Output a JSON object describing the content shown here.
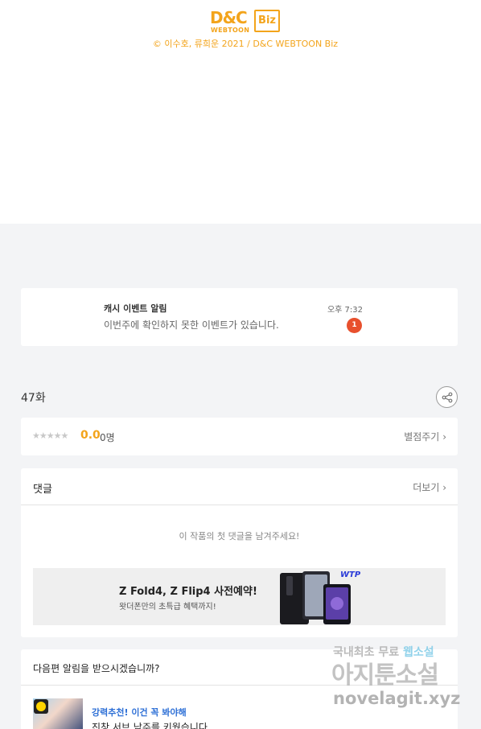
{
  "header": {
    "logo_text": "D&C WEBTOON Biz",
    "logo_dc": "D&C",
    "logo_webtoon": "WEBTOON",
    "logo_biz": "Biz",
    "copyright": "© 이수호, 류희운 2021 / D&C WEBTOON Biz",
    "brand_color": "#f3a41b"
  },
  "notification": {
    "title": "캐시 이벤트 알림",
    "message": "이번주에 확인하지 못한 이벤트가 있습니다.",
    "time": "오후 7:32",
    "badge_count": "1",
    "badge_color": "#e8502d"
  },
  "episode": {
    "title": "47화",
    "share_icon": "share-icon"
  },
  "rating": {
    "stars": "★★★★★",
    "stars_filled": 0,
    "score": "0.0",
    "count": "0명",
    "rate_link": "별점주기"
  },
  "comments": {
    "label": "댓글",
    "more": "더보기",
    "empty_message": "이 작품의 첫 댓글을 남겨주세요!"
  },
  "ad": {
    "title": "Z Fold4, Z Flip4 사전예약!",
    "subtitle": "왓더폰만의 초특급 혜택까지!",
    "logo": "WTP"
  },
  "next_alert": {
    "question": "다음편 알림을 받으시겠습니까?",
    "recommend_label": "강력추천! 이건 꼭 봐야해",
    "recommend_desc": "진창 서브 남주를 키웠습니다",
    "accent_color": "#2d6fd6"
  },
  "watermark": {
    "line1_prefix": "국내최초 무료",
    "line1_highlight": "웹소설",
    "line2": "아지툰소설",
    "line3": "novelagit.xyz"
  },
  "chevron": "›"
}
